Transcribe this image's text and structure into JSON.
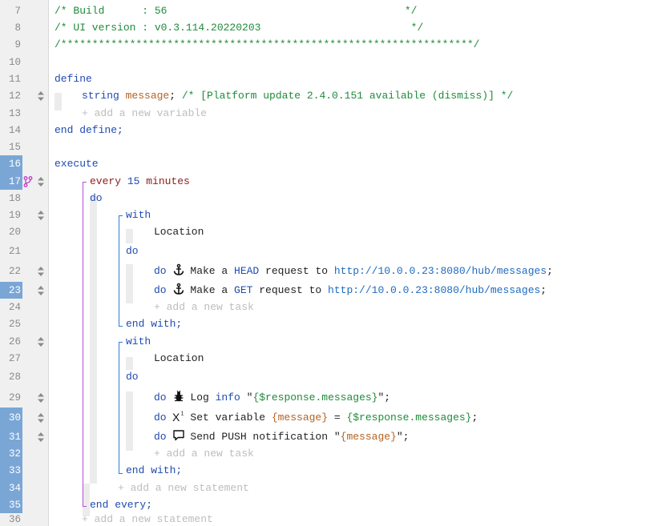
{
  "editor": {
    "rows": [
      {
        "num": "7",
        "hl": false,
        "handle": false,
        "branch": false,
        "tokens": [
          {
            "t": "/* Build      : 56                                      */",
            "k": "cm"
          }
        ]
      },
      {
        "num": "8",
        "hl": false,
        "handle": false,
        "branch": false,
        "tokens": [
          {
            "t": "/* UI version : v0.3.114.20220203                        */",
            "k": "cm"
          }
        ]
      },
      {
        "num": "9",
        "hl": false,
        "handle": false,
        "branch": false,
        "tokens": [
          {
            "t": "/******************************************************************/",
            "k": "cm"
          }
        ]
      },
      {
        "num": "10",
        "hl": false,
        "handle": false,
        "branch": false,
        "tokens": []
      },
      {
        "num": "11",
        "hl": false,
        "handle": false,
        "branch": false,
        "tokens": [
          {
            "t": "define",
            "k": "kw"
          }
        ]
      },
      {
        "num": "12",
        "hl": false,
        "handle": true,
        "branch": false,
        "tokens": [
          {
            "t": "string ",
            "k": "kw"
          },
          {
            "t": "message",
            "k": "var"
          },
          {
            "t": "; ",
            "k": "txt"
          },
          {
            "t": "/* [Platform update 2.4.0.151 available (dismiss)] */",
            "k": "cm"
          }
        ]
      },
      {
        "num": "13",
        "hl": false,
        "handle": false,
        "branch": false,
        "tokens": [
          {
            "t": "+ add a new variable",
            "k": "ph"
          }
        ]
      },
      {
        "num": "14",
        "hl": false,
        "handle": false,
        "branch": false,
        "tokens": [
          {
            "t": "end define;",
            "k": "kw"
          }
        ]
      },
      {
        "num": "15",
        "hl": false,
        "handle": false,
        "branch": false,
        "tokens": []
      },
      {
        "num": "16",
        "hl": true,
        "handle": false,
        "branch": false,
        "tokens": [
          {
            "t": "execute",
            "k": "kw"
          }
        ]
      },
      {
        "num": "17",
        "hl": true,
        "handle": true,
        "branch": true,
        "tokens": [
          {
            "t": "every ",
            "k": "red"
          },
          {
            "t": "15 ",
            "k": "num"
          },
          {
            "t": "minutes",
            "k": "red"
          }
        ]
      },
      {
        "num": "18",
        "hl": false,
        "handle": false,
        "branch": false,
        "tokens": [
          {
            "t": "do",
            "k": "kw"
          }
        ]
      },
      {
        "num": "19",
        "hl": false,
        "handle": true,
        "branch": false,
        "tokens": [
          {
            "t": "with",
            "k": "kw"
          }
        ]
      },
      {
        "num": "20",
        "hl": false,
        "handle": false,
        "branch": false,
        "tokens": [
          {
            "t": "Location",
            "k": "txt"
          }
        ]
      },
      {
        "num": "21",
        "hl": false,
        "handle": false,
        "branch": false,
        "tokens": [
          {
            "t": "do",
            "k": "kw"
          }
        ]
      },
      {
        "num": "22",
        "hl": false,
        "handle": true,
        "branch": false,
        "icon": "anchor-icon",
        "tokens": [
          {
            "t": "do ",
            "k": "kw"
          },
          {
            "t": "@icon",
            "k": "icon"
          },
          {
            "t": "Make a ",
            "k": "txt"
          },
          {
            "t": "HEAD",
            "k": "num"
          },
          {
            "t": " request to ",
            "k": "txt"
          },
          {
            "t": "http://10.0.0.23:8080/hub/messages",
            "k": "url"
          },
          {
            "t": ";",
            "k": "txt"
          }
        ]
      },
      {
        "num": "23",
        "hl": true,
        "handle": true,
        "branch": false,
        "icon": "anchor-icon",
        "tokens": [
          {
            "t": "do ",
            "k": "kw"
          },
          {
            "t": "@icon",
            "k": "icon"
          },
          {
            "t": "Make a ",
            "k": "txt"
          },
          {
            "t": "GET",
            "k": "num"
          },
          {
            "t": " request to ",
            "k": "txt"
          },
          {
            "t": "http://10.0.0.23:8080/hub/messages",
            "k": "url"
          },
          {
            "t": ";",
            "k": "txt"
          }
        ]
      },
      {
        "num": "24",
        "hl": false,
        "handle": false,
        "branch": false,
        "tokens": [
          {
            "t": "+ add a new task",
            "k": "ph"
          }
        ]
      },
      {
        "num": "25",
        "hl": false,
        "handle": false,
        "branch": false,
        "tokens": [
          {
            "t": "end with;",
            "k": "kw"
          }
        ]
      },
      {
        "num": "26",
        "hl": false,
        "handle": true,
        "branch": false,
        "tokens": [
          {
            "t": "with",
            "k": "kw"
          }
        ]
      },
      {
        "num": "27",
        "hl": false,
        "handle": false,
        "branch": false,
        "tokens": [
          {
            "t": "Location",
            "k": "txt"
          }
        ]
      },
      {
        "num": "28",
        "hl": false,
        "handle": false,
        "branch": false,
        "tokens": [
          {
            "t": "do",
            "k": "kw"
          }
        ]
      },
      {
        "num": "29",
        "hl": false,
        "handle": true,
        "branch": false,
        "icon": "bug-icon",
        "tokens": [
          {
            "t": "do ",
            "k": "kw"
          },
          {
            "t": "@icon",
            "k": "icon"
          },
          {
            "t": "Log ",
            "k": "txt"
          },
          {
            "t": "info",
            "k": "num"
          },
          {
            "t": " \"",
            "k": "txt"
          },
          {
            "t": "{$response.messages}",
            "k": "sv"
          },
          {
            "t": "\";",
            "k": "txt"
          }
        ]
      },
      {
        "num": "30",
        "hl": true,
        "handle": true,
        "branch": false,
        "icon": "variable-icon",
        "tokens": [
          {
            "t": "do ",
            "k": "kw"
          },
          {
            "t": "@icon",
            "k": "icon"
          },
          {
            "t": "Set variable ",
            "k": "txt"
          },
          {
            "t": "{message}",
            "k": "var"
          },
          {
            "t": " = ",
            "k": "txt"
          },
          {
            "t": "{$response.messages}",
            "k": "sv"
          },
          {
            "t": ";",
            "k": "txt"
          }
        ]
      },
      {
        "num": "31",
        "hl": true,
        "handle": true,
        "branch": false,
        "icon": "speech-bubble-icon",
        "tokens": [
          {
            "t": "do ",
            "k": "kw"
          },
          {
            "t": "@icon",
            "k": "icon"
          },
          {
            "t": "Send PUSH notification \"",
            "k": "txt"
          },
          {
            "t": "{message}",
            "k": "var"
          },
          {
            "t": "\";",
            "k": "txt"
          }
        ]
      },
      {
        "num": "32",
        "hl": true,
        "handle": false,
        "branch": false,
        "tokens": [
          {
            "t": "+ add a new task",
            "k": "ph"
          }
        ]
      },
      {
        "num": "33",
        "hl": true,
        "handle": false,
        "branch": false,
        "tokens": [
          {
            "t": "end with;",
            "k": "kw"
          }
        ]
      },
      {
        "num": "34",
        "hl": true,
        "handle": false,
        "branch": false,
        "tokens": [
          {
            "t": "+ add a new statement",
            "k": "ph"
          }
        ]
      },
      {
        "num": "35",
        "hl": true,
        "handle": false,
        "branch": false,
        "tokens": [
          {
            "t": "end every;",
            "k": "kw"
          }
        ]
      },
      {
        "num": "36",
        "hl": false,
        "handle": false,
        "branch": false,
        "tokens": [
          {
            "t": "+ add a new statement",
            "k": "ph"
          }
        ]
      }
    ]
  },
  "colors": {
    "gutter_highlight": "#7aa6d6",
    "bracket": "#b44fd6",
    "inner_bracket": "#2e7bd8"
  }
}
